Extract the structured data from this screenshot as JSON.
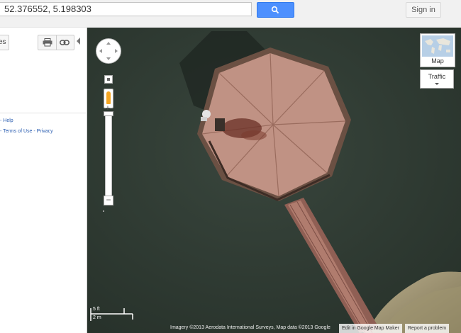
{
  "search": {
    "value": "52.376552, 5.198303"
  },
  "header": {
    "signin_label": "Sign in"
  },
  "left_panel": {
    "tab_label": "es",
    "help_text": "Help",
    "terms_text": "Terms of Use",
    "privacy_text": "Privacy",
    "separator": "-"
  },
  "map": {
    "map_type_label": "Map",
    "traffic_label": "Traffic",
    "scale": {
      "feet": "5 ft",
      "meters": "2 m"
    },
    "attribution": "Imagery ©2013 Aerodata International Surveys, Map data ©2013 Google",
    "edit_link": "Edit in Google Map Maker",
    "report_link": "Report a problem"
  },
  "colors": {
    "search_button": "#4d90fe",
    "link": "#2a5db0",
    "water": "#2f3a33",
    "pier": "#b98a7a"
  }
}
